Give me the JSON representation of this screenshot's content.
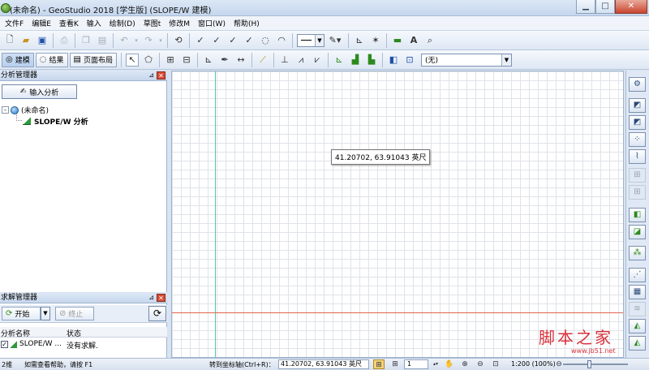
{
  "window": {
    "title": "(未命名) - GeoStudio 2018 [学生版] (SLOPE/W 建模)"
  },
  "menu": [
    "文件F",
    "编辑E",
    "查看K",
    "输入",
    "绘制(D)",
    "草图t",
    "修改M",
    "窗口(W)",
    "帮助(H)"
  ],
  "toolbar2": {
    "mode_model": "建模",
    "mode_results": "结果",
    "page_layout": "页面布局",
    "combo_value": "(无)"
  },
  "analysis_manager": {
    "title": "分析管理器",
    "input_button": "输入分析",
    "root_label": "(未命名)",
    "root_expander": "-",
    "child_label": "SLOPE/W 分析"
  },
  "solve_manager": {
    "title": "求解管理器",
    "start_label": "开始",
    "stop_label": "终止",
    "columns": [
      "分析名称",
      "状态"
    ],
    "rows": [
      {
        "name": "SLOPE/W ...",
        "status": "没有求解."
      }
    ]
  },
  "canvas": {
    "tooltip": "41.20702, 63.91043 英尺",
    "watermark": "脚本之家",
    "watermark_url": "www.jb51.net"
  },
  "status": {
    "dim": "2维",
    "help": "如需查看帮助，请按 F1",
    "snap_label": "转到坐标轴(Ctrl+R)：",
    "coords": "41.20702, 63.91043 英尺",
    "spin_value": "1",
    "scale": "1:200 (100%)"
  },
  "icons": {
    "app": "geostudio-logo-icon",
    "new": "new-file-icon",
    "open": "open-folder-icon",
    "save": "save-icon",
    "print": "print-icon",
    "undo": "undo-icon",
    "redo": "redo-icon",
    "refresh": "refresh-icon"
  },
  "colors": {
    "y_axis": "#4fc9a8",
    "x_axis": "#e0664c",
    "watermark": "#d8303b"
  }
}
